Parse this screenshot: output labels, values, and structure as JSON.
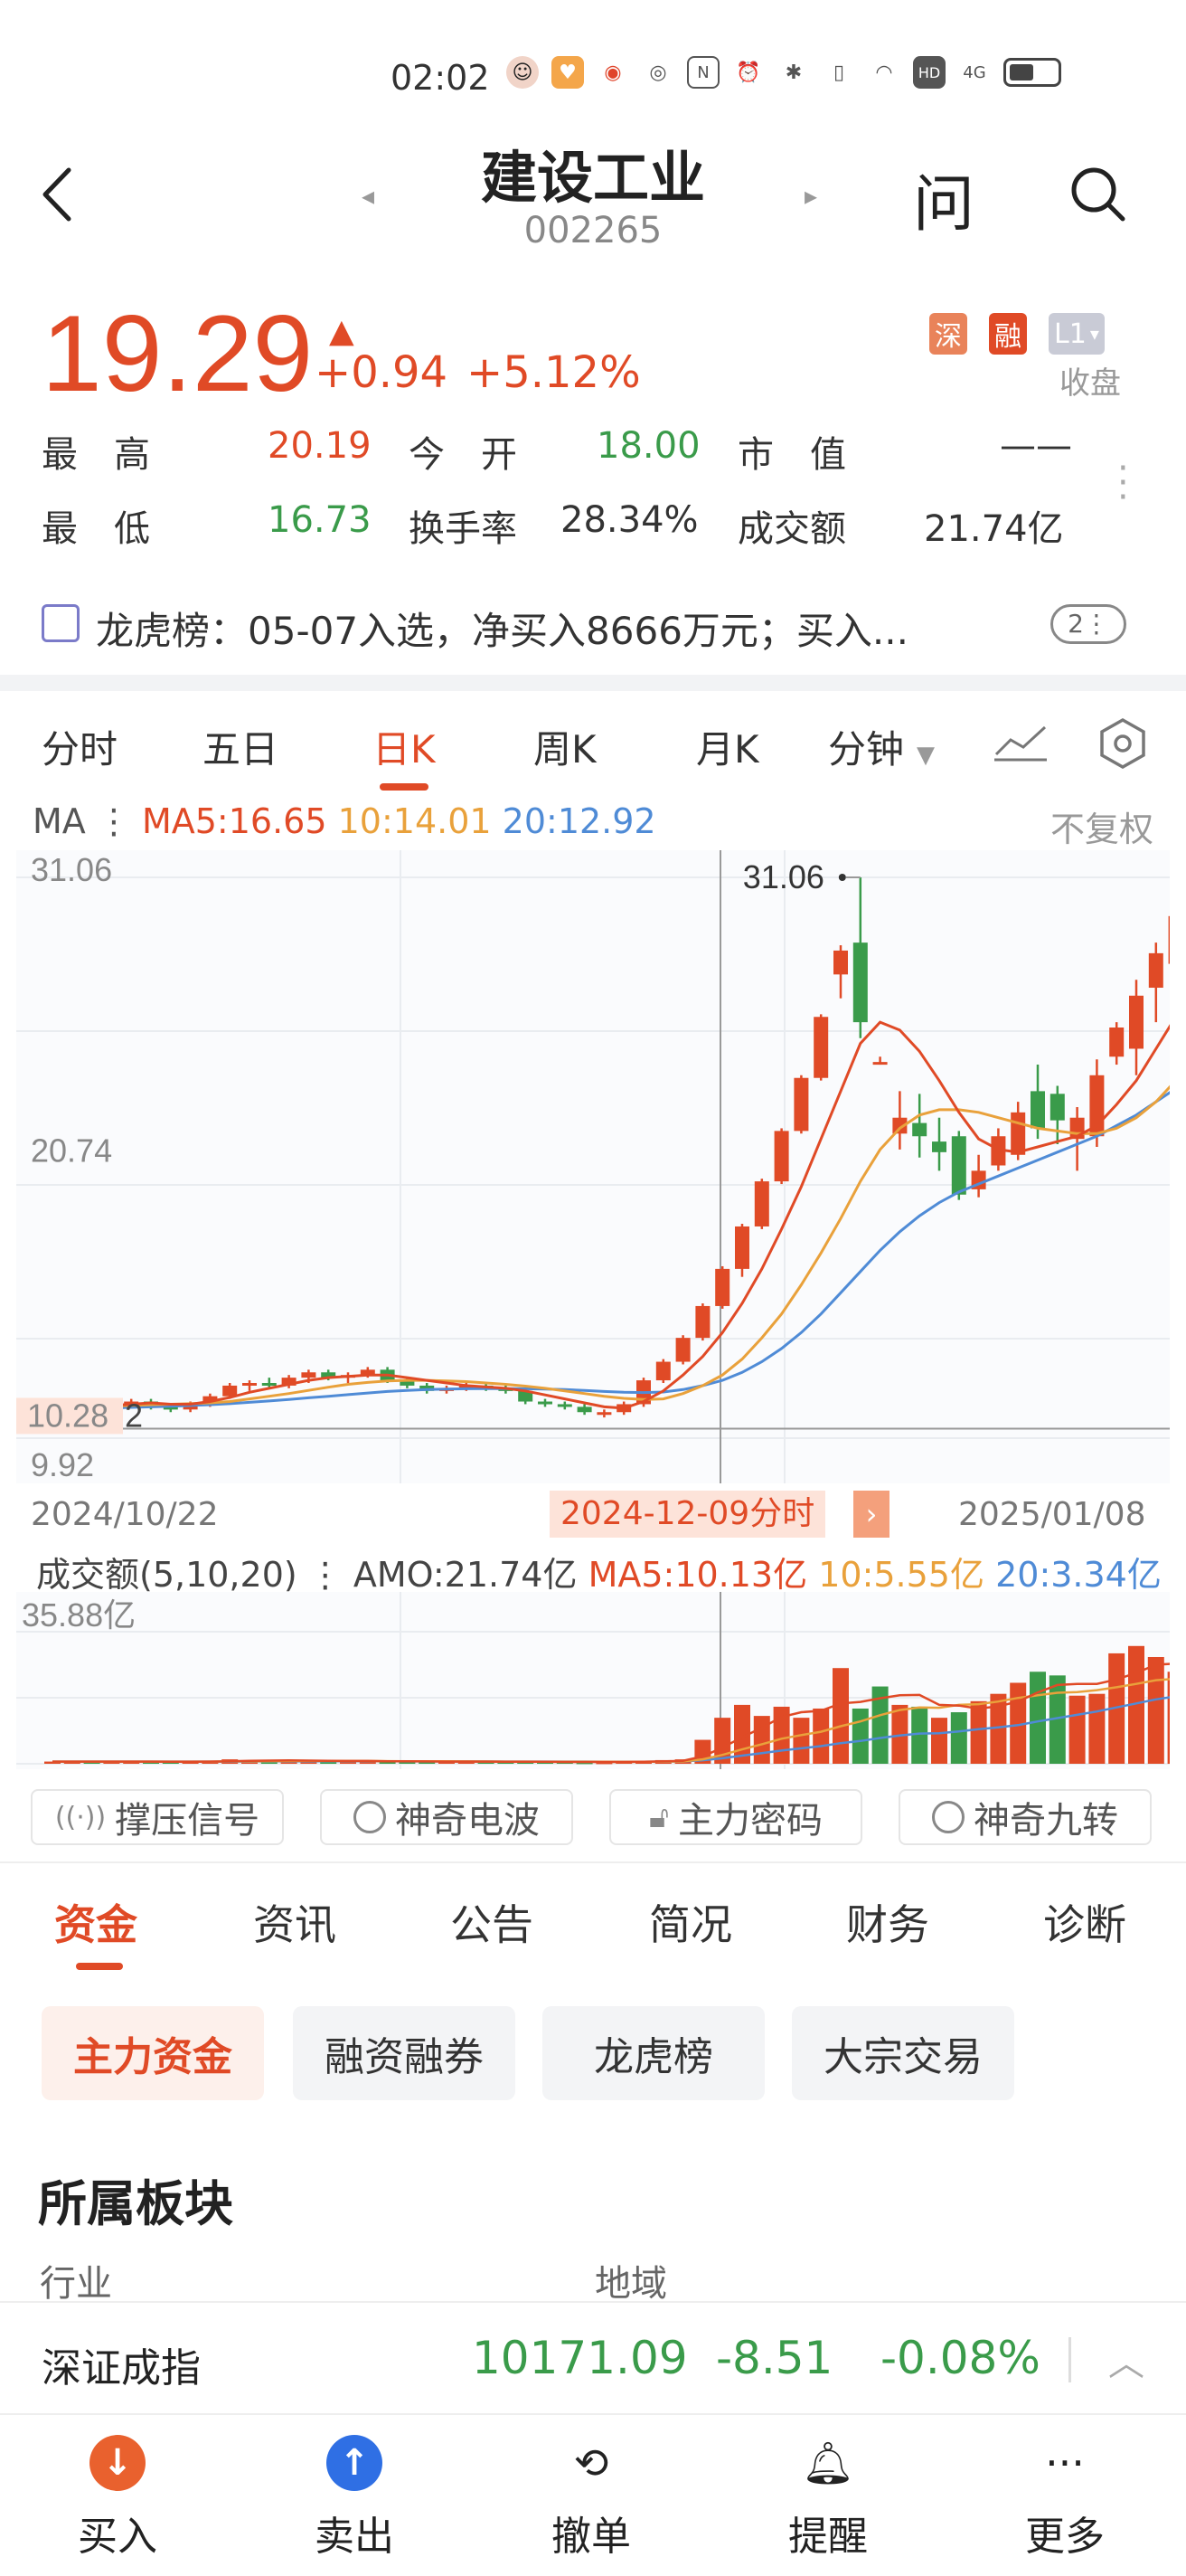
{
  "status_bar": {
    "time": "02:02",
    "signal": "4G",
    "hd": "HD"
  },
  "header": {
    "title": "建设工业",
    "code": "002265",
    "ask": "问"
  },
  "quote": {
    "price": "19.29",
    "change": "+0.94",
    "change_pct": "+5.12%",
    "badges": [
      "深",
      "融",
      "L1"
    ],
    "status": "收盘",
    "stats": [
      {
        "label": "最　高",
        "value": "20.19",
        "color": "red"
      },
      {
        "label": "今　开",
        "value": "18.00",
        "color": "green"
      },
      {
        "label": "市　值",
        "value": "——",
        "color": "neutral"
      },
      {
        "label": "最　低",
        "value": "16.73",
        "color": "green"
      },
      {
        "label": "换手率",
        "value": "28.34%",
        "color": "neutral"
      },
      {
        "label": "成交额",
        "value": "21.74亿",
        "color": "neutral"
      }
    ]
  },
  "dragon_tiger": {
    "text": "龙虎榜：05-07入选，净买入8666万元；买入...",
    "count": "2⋮"
  },
  "chart_tabs": [
    "分时",
    "五日",
    "日K",
    "周K",
    "月K",
    "分钟"
  ],
  "chart_tab_active": "日K",
  "ma_legend": {
    "label": "MA ⋮",
    "ma5": "MA5:16.65",
    "ma10": "10:14.01",
    "ma20": "20:12.92",
    "adjust": "不复权"
  },
  "chart_data": {
    "type": "candlestick",
    "y_labels": {
      "top": "31.06",
      "mid": "20.74",
      "low_mark": "10.28",
      "low_mark_suffix": "2",
      "bottom": "9.92"
    },
    "max_label": "31.06",
    "ylim": [
      9.92,
      31.06
    ],
    "dates": {
      "start": "2024/10/22",
      "selected": "2024-12-09分时",
      "end": "2025/01/08"
    },
    "candles": [
      {
        "o": 11.0,
        "h": 11.2,
        "l": 10.9,
        "c": 11.1
      },
      {
        "o": 11.1,
        "h": 11.3,
        "l": 11.0,
        "c": 11.2
      },
      {
        "o": 11.2,
        "h": 11.3,
        "l": 11.0,
        "c": 11.1
      },
      {
        "o": 11.1,
        "h": 11.3,
        "l": 11.0,
        "c": 11.2
      },
      {
        "o": 11.2,
        "h": 11.4,
        "l": 11.1,
        "c": 11.3
      },
      {
        "o": 11.3,
        "h": 11.4,
        "l": 11.0,
        "c": 11.1
      },
      {
        "o": 11.1,
        "h": 11.2,
        "l": 10.9,
        "c": 11.0
      },
      {
        "o": 11.0,
        "h": 11.3,
        "l": 10.9,
        "c": 11.2
      },
      {
        "o": 11.2,
        "h": 11.6,
        "l": 11.1,
        "c": 11.5
      },
      {
        "o": 11.5,
        "h": 12.0,
        "l": 11.4,
        "c": 11.9
      },
      {
        "o": 11.9,
        "h": 12.1,
        "l": 11.7,
        "c": 12.0
      },
      {
        "o": 12.0,
        "h": 12.2,
        "l": 11.8,
        "c": 11.9
      },
      {
        "o": 11.9,
        "h": 12.3,
        "l": 11.8,
        "c": 12.2
      },
      {
        "o": 12.2,
        "h": 12.5,
        "l": 12.0,
        "c": 12.4
      },
      {
        "o": 12.4,
        "h": 12.5,
        "l": 12.1,
        "c": 12.2
      },
      {
        "o": 12.2,
        "h": 12.4,
        "l": 12.0,
        "c": 12.3
      },
      {
        "o": 12.3,
        "h": 12.6,
        "l": 12.2,
        "c": 12.5
      },
      {
        "o": 12.5,
        "h": 12.6,
        "l": 12.0,
        "c": 12.1
      },
      {
        "o": 12.1,
        "h": 12.2,
        "l": 11.8,
        "c": 11.9
      },
      {
        "o": 11.9,
        "h": 12.0,
        "l": 11.6,
        "c": 11.7
      },
      {
        "o": 11.7,
        "h": 11.9,
        "l": 11.6,
        "c": 11.8
      },
      {
        "o": 11.8,
        "h": 12.0,
        "l": 11.7,
        "c": 11.9
      },
      {
        "o": 11.9,
        "h": 12.0,
        "l": 11.7,
        "c": 11.8
      },
      {
        "o": 11.8,
        "h": 11.9,
        "l": 11.6,
        "c": 11.7
      },
      {
        "o": 11.7,
        "h": 11.8,
        "l": 11.2,
        "c": 11.3
      },
      {
        "o": 11.3,
        "h": 11.4,
        "l": 11.1,
        "c": 11.2
      },
      {
        "o": 11.2,
        "h": 11.3,
        "l": 11.0,
        "c": 11.1
      },
      {
        "o": 11.1,
        "h": 11.2,
        "l": 10.8,
        "c": 10.9
      },
      {
        "o": 10.9,
        "h": 11.0,
        "l": 10.7,
        "c": 10.9
      },
      {
        "o": 10.9,
        "h": 11.3,
        "l": 10.8,
        "c": 11.2
      },
      {
        "o": 11.2,
        "h": 12.2,
        "l": 11.1,
        "c": 12.1
      },
      {
        "o": 12.1,
        "h": 12.9,
        "l": 12.0,
        "c": 12.8
      },
      {
        "o": 12.8,
        "h": 13.8,
        "l": 12.7,
        "c": 13.7
      },
      {
        "o": 13.7,
        "h": 15.0,
        "l": 13.6,
        "c": 14.9
      },
      {
        "o": 14.9,
        "h": 16.4,
        "l": 14.8,
        "c": 16.3
      },
      {
        "o": 16.3,
        "h": 18.0,
        "l": 16.0,
        "c": 17.9
      },
      {
        "o": 17.9,
        "h": 19.7,
        "l": 17.8,
        "c": 19.6
      },
      {
        "o": 19.6,
        "h": 21.6,
        "l": 19.5,
        "c": 21.5
      },
      {
        "o": 21.5,
        "h": 23.6,
        "l": 21.4,
        "c": 23.5
      },
      {
        "o": 23.5,
        "h": 25.9,
        "l": 23.4,
        "c": 25.8
      },
      {
        "o": 27.4,
        "h": 28.5,
        "l": 26.5,
        "c": 28.3
      },
      {
        "o": 28.6,
        "h": 31.06,
        "l": 25.0,
        "c": 25.6
      },
      {
        "o": 24.1,
        "h": 24.3,
        "l": 24.0,
        "c": 24.1
      },
      {
        "o": 21.4,
        "h": 23.0,
        "l": 20.8,
        "c": 22.0
      },
      {
        "o": 21.8,
        "h": 22.9,
        "l": 20.5,
        "c": 21.3
      },
      {
        "o": 21.1,
        "h": 22.0,
        "l": 20.0,
        "c": 20.7
      },
      {
        "o": 21.3,
        "h": 21.5,
        "l": 18.9,
        "c": 19.1
      },
      {
        "o": 19.3,
        "h": 20.6,
        "l": 19.0,
        "c": 20.0
      },
      {
        "o": 20.2,
        "h": 21.6,
        "l": 20.0,
        "c": 21.3
      },
      {
        "o": 20.6,
        "h": 22.6,
        "l": 20.4,
        "c": 22.2
      },
      {
        "o": 23.0,
        "h": 24.0,
        "l": 21.2,
        "c": 21.6
      },
      {
        "o": 22.9,
        "h": 23.2,
        "l": 21.0,
        "c": 21.9
      },
      {
        "o": 21.2,
        "h": 22.4,
        "l": 20.0,
        "c": 22.0
      },
      {
        "o": 21.3,
        "h": 24.2,
        "l": 20.9,
        "c": 23.6
      },
      {
        "o": 24.3,
        "h": 25.6,
        "l": 24.0,
        "c": 25.4
      },
      {
        "o": 24.6,
        "h": 27.2,
        "l": 23.6,
        "c": 26.6
      },
      {
        "o": 26.9,
        "h": 28.6,
        "l": 25.6,
        "c": 28.2
      },
      {
        "o": 27.8,
        "h": 30.0,
        "l": 26.0,
        "c": 29.6
      }
    ],
    "ma5": [
      11.0,
      11.05,
      11.1,
      11.15,
      11.2,
      11.25,
      11.2,
      11.2,
      11.3,
      11.45,
      11.65,
      11.8,
      11.95,
      12.1,
      12.2,
      12.25,
      12.3,
      12.3,
      12.2,
      12.1,
      12.0,
      11.9,
      11.85,
      11.8,
      11.7,
      11.55,
      11.4,
      11.25,
      11.1,
      11.05,
      11.3,
      11.7,
      12.3,
      13.0,
      13.9,
      15.0,
      16.3,
      17.8,
      19.4,
      21.2,
      23.0,
      24.8,
      25.6,
      25.3,
      24.5,
      23.4,
      22.2,
      21.2,
      20.8,
      20.7,
      20.9,
      21.1,
      21.3,
      21.7,
      22.5,
      23.4,
      24.6,
      25.8
    ],
    "ma10": [
      11.1,
      11.1,
      11.1,
      11.12,
      11.15,
      11.18,
      11.2,
      11.22,
      11.25,
      11.3,
      11.4,
      11.5,
      11.6,
      11.72,
      11.84,
      11.95,
      12.02,
      12.08,
      12.1,
      12.1,
      12.08,
      12.05,
      12.0,
      11.95,
      11.88,
      11.8,
      11.7,
      11.6,
      11.5,
      11.42,
      11.38,
      11.4,
      11.6,
      11.9,
      12.3,
      12.9,
      13.7,
      14.6,
      15.7,
      16.9,
      18.2,
      19.6,
      20.8,
      21.6,
      22.1,
      22.3,
      22.3,
      22.2,
      22.0,
      21.8,
      21.6,
      21.5,
      21.4,
      21.4,
      21.6,
      22.0,
      22.6,
      23.4
    ],
    "ma20": [
      11.0,
      11.02,
      11.04,
      11.06,
      11.08,
      11.1,
      11.12,
      11.15,
      11.18,
      11.22,
      11.27,
      11.32,
      11.38,
      11.44,
      11.5,
      11.56,
      11.62,
      11.68,
      11.72,
      11.75,
      11.77,
      11.78,
      11.79,
      11.79,
      11.78,
      11.77,
      11.75,
      11.72,
      11.68,
      11.65,
      11.64,
      11.66,
      11.75,
      11.9,
      12.1,
      12.4,
      12.8,
      13.3,
      13.9,
      14.6,
      15.4,
      16.2,
      17.0,
      17.7,
      18.3,
      18.8,
      19.2,
      19.5,
      19.8,
      20.1,
      20.4,
      20.7,
      21.0,
      21.3,
      21.7,
      22.1,
      22.6,
      23.1
    ]
  },
  "amo_legend": {
    "label": "成交额(5,10,20) ⋮ AMO:21.74亿",
    "ma5": "MA5:10.13亿",
    "ma10": "10:5.55亿",
    "ma20": "20:3.34亿",
    "max": "35.88亿"
  },
  "volume_data": {
    "ylim": [
      0,
      35.88
    ],
    "values": [
      0.6,
      0.5,
      0.6,
      0.5,
      0.6,
      0.5,
      0.5,
      0.6,
      0.8,
      1.2,
      0.9,
      0.8,
      0.7,
      0.8,
      0.7,
      0.6,
      0.8,
      0.7,
      0.6,
      0.6,
      0.5,
      0.6,
      0.6,
      0.5,
      0.6,
      0.5,
      0.5,
      0.4,
      0.4,
      0.5,
      0.8,
      1.0,
      1.2,
      6.5,
      12.5,
      16.0,
      13.0,
      15.5,
      12.5,
      15.0,
      26.0,
      15.0,
      21.0,
      16.0,
      15.5,
      12.5,
      14.0,
      17.0,
      19.0,
      22.0,
      25.0,
      24.0,
      18.5,
      19.0,
      30.0,
      32.0,
      29.0,
      25.0
    ],
    "up": [
      true,
      true,
      false,
      true,
      true,
      false,
      false,
      true,
      true,
      true,
      true,
      false,
      true,
      true,
      false,
      true,
      true,
      false,
      false,
      false,
      true,
      true,
      false,
      false,
      false,
      false,
      false,
      false,
      true,
      true,
      true,
      true,
      true,
      true,
      true,
      true,
      true,
      true,
      true,
      true,
      true,
      false,
      false,
      true,
      false,
      true,
      false,
      true,
      true,
      true,
      false,
      false,
      true,
      true,
      true,
      true,
      true,
      true
    ],
    "ma5": [
      0.6,
      0.6,
      0.6,
      0.6,
      0.6,
      0.6,
      0.55,
      0.55,
      0.6,
      0.7,
      0.8,
      0.85,
      0.9,
      0.85,
      0.8,
      0.75,
      0.75,
      0.7,
      0.7,
      0.65,
      0.6,
      0.6,
      0.6,
      0.55,
      0.55,
      0.55,
      0.5,
      0.5,
      0.5,
      0.5,
      0.55,
      0.65,
      0.8,
      2.0,
      4.4,
      7.2,
      9.8,
      12.7,
      14.0,
      14.4,
      16.4,
      16.8,
      17.8,
      18.6,
      18.7,
      16.0,
      15.8,
      15.0,
      15.6,
      16.9,
      19.4,
      21.4,
      21.7,
      21.7,
      22.9,
      24.7,
      26.9,
      27.2
    ],
    "ma10": [
      0.6,
      0.6,
      0.6,
      0.6,
      0.6,
      0.6,
      0.6,
      0.6,
      0.6,
      0.65,
      0.7,
      0.72,
      0.74,
      0.75,
      0.75,
      0.75,
      0.75,
      0.72,
      0.7,
      0.68,
      0.66,
      0.64,
      0.62,
      0.6,
      0.58,
      0.56,
      0.55,
      0.54,
      0.53,
      0.52,
      0.53,
      0.58,
      0.65,
      1.2,
      2.4,
      3.9,
      5.3,
      6.8,
      7.8,
      8.7,
      10.2,
      11.5,
      13.2,
      14.6,
      15.3,
      15.2,
      16.0,
      16.2,
      16.9,
      17.9,
      18.6,
      19.3,
      19.5,
      20.0,
      20.8,
      21.7,
      22.7,
      23.1
    ],
    "ma20": [
      0.6,
      0.6,
      0.6,
      0.6,
      0.6,
      0.6,
      0.6,
      0.6,
      0.6,
      0.6,
      0.62,
      0.63,
      0.64,
      0.65,
      0.66,
      0.67,
      0.67,
      0.66,
      0.65,
      0.64,
      0.63,
      0.62,
      0.61,
      0.6,
      0.6,
      0.59,
      0.59,
      0.58,
      0.57,
      0.56,
      0.57,
      0.6,
      0.65,
      0.95,
      1.5,
      2.2,
      2.9,
      3.6,
      4.2,
      4.8,
      5.6,
      6.2,
      7.0,
      7.7,
      8.2,
      8.3,
      8.8,
      9.4,
      9.9,
      10.5,
      11.5,
      12.4,
      13.3,
      14.2,
      15.3,
      16.4,
      17.5,
      18.3
    ]
  },
  "indicators": [
    "撑压信号",
    "神奇电波",
    "主力密码",
    "神奇九转"
  ],
  "info_tabs": [
    "资金",
    "资讯",
    "公告",
    "简况",
    "财务",
    "诊断"
  ],
  "info_tab_active": "资金",
  "chips": [
    "主力资金",
    "融资融券",
    "龙虎榜",
    "大宗交易"
  ],
  "sector": {
    "title": "所属板块",
    "industry": "行业",
    "region": "地域"
  },
  "ticker": {
    "name": "深证成指",
    "value": "10171.09",
    "change": "-8.51",
    "pct": "-0.08%"
  },
  "bottom_nav": [
    {
      "label": "买入",
      "icon": "buy-icon"
    },
    {
      "label": "卖出",
      "icon": "sell-icon"
    },
    {
      "label": "撤单",
      "icon": "cancel-order-icon"
    },
    {
      "label": "提醒",
      "icon": "bell-icon"
    },
    {
      "label": "更多",
      "icon": "more-icon"
    }
  ],
  "colors": {
    "up": "#e04a26",
    "down": "#3a9b4a",
    "ma5": "#e04a26",
    "ma10": "#e9a13b",
    "ma20": "#4f8bd6"
  }
}
